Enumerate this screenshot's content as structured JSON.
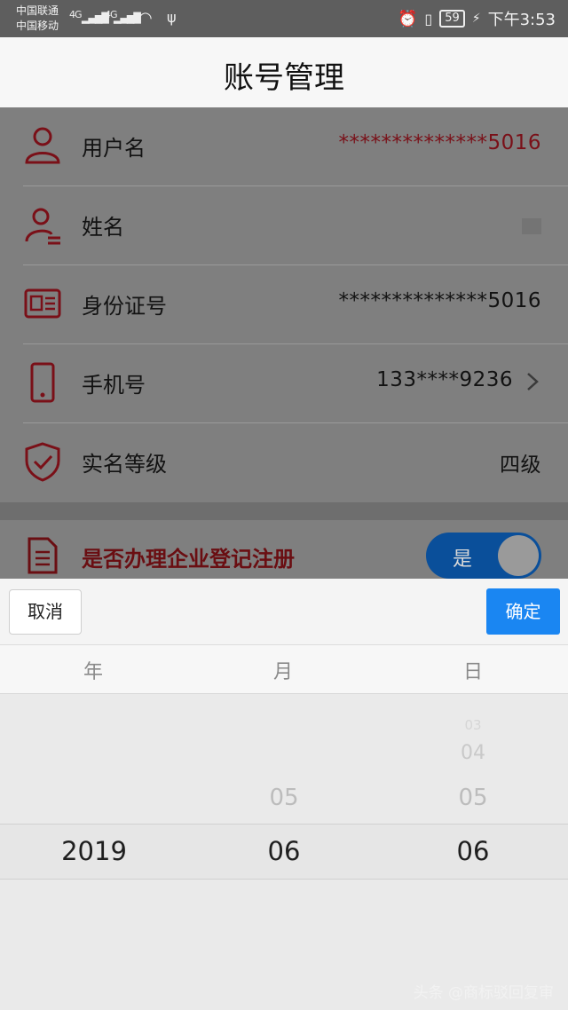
{
  "status_bar": {
    "carrier1": "中国联通",
    "carrier2": "中国移动",
    "net1": "4G",
    "net2": "4G",
    "battery": "59",
    "time": "下午3:53"
  },
  "header": {
    "title": "账号管理"
  },
  "rows": [
    {
      "label": "用户名",
      "value": "**************5016",
      "icon": "user-icon"
    },
    {
      "label": "姓名",
      "value": "",
      "icon": "person-list-icon"
    },
    {
      "label": "身份证号",
      "value": "**************5016",
      "icon": "id-card-icon"
    },
    {
      "label": "手机号",
      "value": "133****9236",
      "icon": "phone-icon"
    },
    {
      "label": "实名等级",
      "value": "四级",
      "icon": "shield-check-icon"
    }
  ],
  "registration": {
    "label": "是否办理企业登记注册",
    "toggle_text": "是",
    "icon": "document-icon"
  },
  "picker": {
    "cancel_label": "取消",
    "confirm_label": "确定",
    "columns": [
      "年",
      "月",
      "日"
    ],
    "year": {
      "selected": "2019"
    },
    "month": {
      "above": "05",
      "selected": "06"
    },
    "day": {
      "above3": "03",
      "above2": "04",
      "above1": "05",
      "selected": "06"
    }
  },
  "watermark": "头条 @商标驳回复审",
  "colors": {
    "accent_red": "#7a1018",
    "primary_blue": "#1a86f2"
  }
}
